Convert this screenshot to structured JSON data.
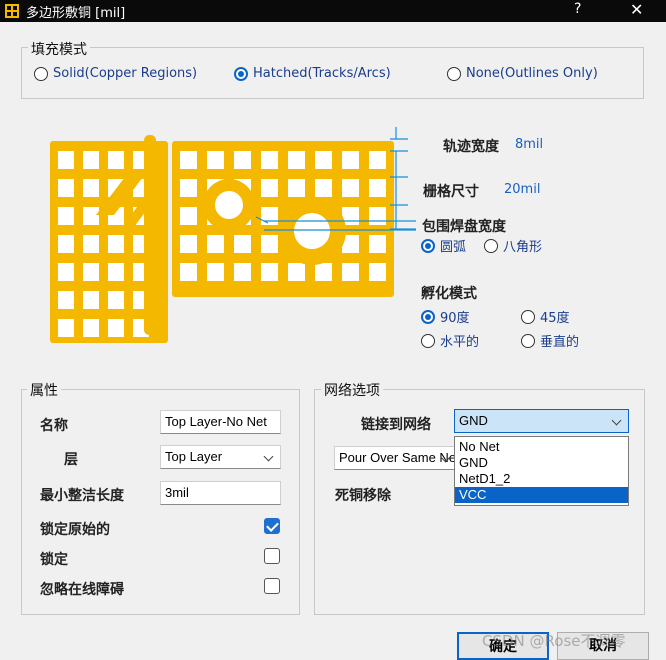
{
  "window": {
    "title": "多边形敷铜 [mil]",
    "help": "?",
    "close": "✕"
  },
  "fill_mode": {
    "legend": "填充模式",
    "options": [
      {
        "label": "Solid(Copper Regions)",
        "selected": false
      },
      {
        "label": "Hatched(Tracks/Arcs)",
        "selected": true
      },
      {
        "label": "None(Outlines Only)",
        "selected": false
      }
    ]
  },
  "hatch": {
    "track_width_label": "轨迹宽度",
    "track_width_value": "8mil",
    "grid_size_label": "栅格尺寸",
    "grid_size_value": "20mil",
    "surround_label": "包围焊盘宽度",
    "surround_options": [
      {
        "label": "圆弧",
        "selected": true
      },
      {
        "label": "八角形",
        "selected": false
      }
    ],
    "hatch_mode_label": "孵化模式",
    "hatch_options": [
      {
        "label": "90度",
        "selected": true
      },
      {
        "label": "45度",
        "selected": false
      },
      {
        "label": "水平的",
        "selected": false
      },
      {
        "label": "垂直的",
        "selected": false
      }
    ],
    "preview_color": "#f5b800"
  },
  "properties": {
    "legend": "属性",
    "name_label": "名称",
    "name_value": "Top Layer-No Net",
    "layer_label": "层",
    "layer_value": "Top Layer",
    "min_len_label": "最小整洁长度",
    "min_len_value": "3mil",
    "lock_primitives_label": "锁定原始的",
    "lock_primitives_checked": true,
    "locked_label": "锁定",
    "locked_checked": false,
    "ignore_label": "忽略在线障碍",
    "ignore_checked": false
  },
  "net_options": {
    "legend": "网络选项",
    "connect_label": "链接到网络",
    "connect_value": "GND",
    "pour_value": "Pour Over Same Ne",
    "dead_copper_label": "死铜移除",
    "dropdown_items": [
      "No Net",
      "GND",
      "NetD1_2",
      "VCC"
    ],
    "dropdown_selected_index": 3
  },
  "buttons": {
    "ok": "确定",
    "cancel": "取消"
  },
  "watermark": "CSDN @Rose不凋零"
}
